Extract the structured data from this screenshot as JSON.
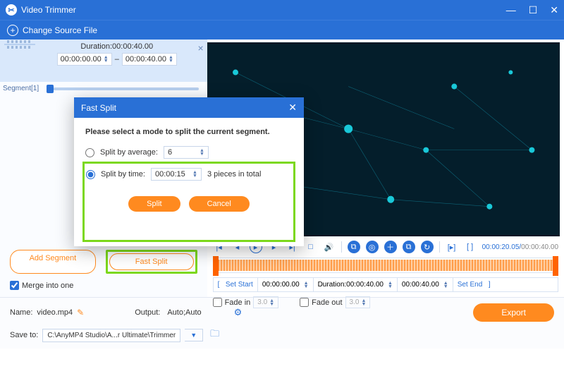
{
  "titlebar": {
    "app_name": "Video Trimmer"
  },
  "toolbar": {
    "change_source_label": "Change Source File"
  },
  "segment": {
    "label": "Segment[1]",
    "duration_label": "Duration:00:00:40.00",
    "start": "00:00:00.00",
    "end": "00:00:40.00"
  },
  "dialog": {
    "title": "Fast Split",
    "prompt": "Please select a mode to split the current segment.",
    "opt_avg_label": "Split by average:",
    "opt_avg_value": "6",
    "opt_time_label": "Split by time:",
    "opt_time_value": "00:00:15",
    "opt_time_result": "3 pieces in total",
    "btn_split": "Split",
    "btn_cancel": "Cancel"
  },
  "leftactions": {
    "add_segment": "Add Segment",
    "fast_split": "Fast Split",
    "merge_label": "Merge into one"
  },
  "player": {
    "current": "00:00:20.05",
    "total": "00:00:40.00"
  },
  "range": {
    "set_start": "Set Start",
    "start": "00:00:00.00",
    "duration_label": "Duration:00:00:40.00",
    "end": "00:00:40.00",
    "set_end": "Set End"
  },
  "fade": {
    "in_label": "Fade in",
    "in_value": "3.0",
    "out_label": "Fade out",
    "out_value": "3.0"
  },
  "bottom": {
    "name_label": "Name:",
    "name_value": "video.mp4",
    "output_label": "Output:",
    "output_value": "Auto;Auto",
    "save_label": "Save to:",
    "save_path": "C:\\AnyMP4 Studio\\A...r Ultimate\\Trimmer",
    "export": "Export"
  }
}
